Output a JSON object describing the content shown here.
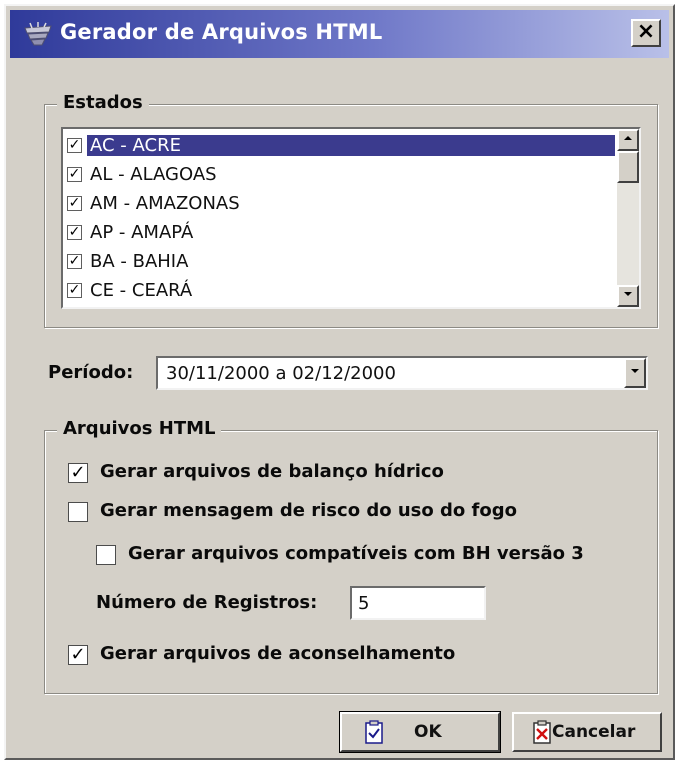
{
  "window": {
    "title": "Gerador de Arquivos HTML",
    "close_label": "×"
  },
  "estados": {
    "label": "Estados",
    "items": [
      {
        "label": "AC - ACRE",
        "checked": true,
        "selected": true
      },
      {
        "label": "AL - ALAGOAS",
        "checked": true,
        "selected": false
      },
      {
        "label": "AM - AMAZONAS",
        "checked": true,
        "selected": false
      },
      {
        "label": "AP - AMAPÁ",
        "checked": true,
        "selected": false
      },
      {
        "label": "BA - BAHIA",
        "checked": true,
        "selected": false
      },
      {
        "label": "CE - CEARÁ",
        "checked": true,
        "selected": false
      }
    ]
  },
  "periodo": {
    "label": "Período:",
    "value": "30/11/2000 a 02/12/2000"
  },
  "arquivos": {
    "label": "Arquivos HTML",
    "balanco": {
      "label": "Gerar arquivos de balanço hídrico",
      "checked": true
    },
    "risco": {
      "label": "Gerar mensagem de risco do uso do fogo",
      "checked": false
    },
    "compat": {
      "label": "Gerar arquivos compatíveis com BH versão 3",
      "checked": false
    },
    "registros_label": "Número de Registros:",
    "registros_value": "5",
    "aconselhamento": {
      "label": "Gerar arquivos de aconselhamento",
      "checked": true
    }
  },
  "buttons": {
    "ok": "OK",
    "cancel": "Cancelar"
  },
  "check_mark": "✓"
}
